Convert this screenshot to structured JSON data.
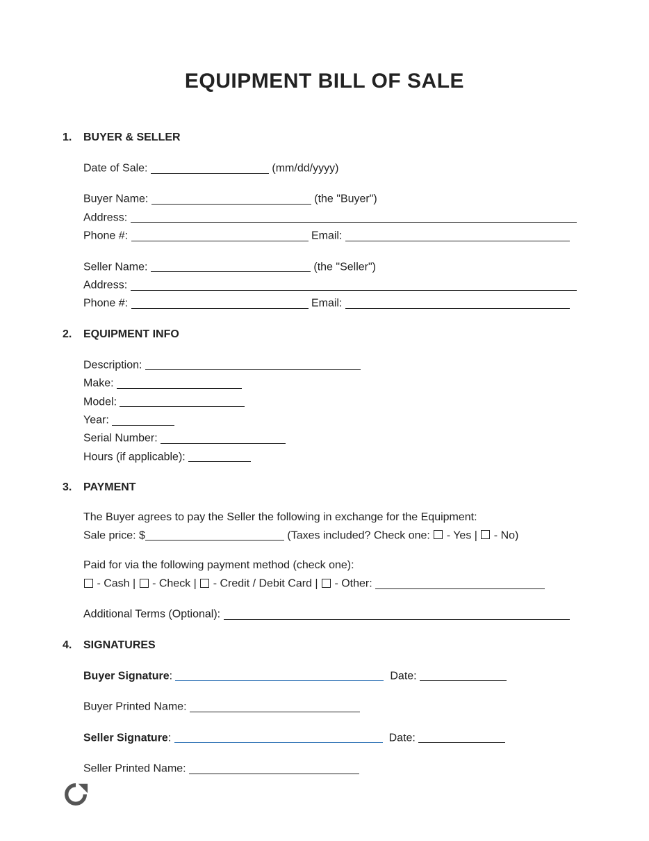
{
  "title": "EQUIPMENT BILL OF SALE",
  "s1": {
    "num": "1.",
    "heading": "BUYER & SELLER",
    "dateOfSale": "Date of Sale: ",
    "dateHint": " (mm/dd/yyyy)",
    "buyerName": "Buyer Name: ",
    "buyerTag": " (the \"Buyer\")",
    "address": "Address: ",
    "phone": "Phone #: ",
    "email": " Email: ",
    "sellerName": "Seller Name: ",
    "sellerTag": " (the \"Seller\")"
  },
  "s2": {
    "num": "2.",
    "heading": "EQUIPMENT INFO",
    "description": "Description: ",
    "make": "Make: ",
    "model": "Model: ",
    "year": "Year: ",
    "serial": "Serial Number: ",
    "hours": "Hours (if applicable): "
  },
  "s3": {
    "num": "3.",
    "heading": "PAYMENT",
    "intro": "The Buyer agrees to pay the Seller the following in exchange for the Equipment:",
    "salePrice": "Sale price: $",
    "taxesQ": " (Taxes included? Check one: ",
    "yes": " - Yes | ",
    "no": " - No)",
    "paidVia": "Paid for via the following payment method (check one):",
    "cash": " - Cash | ",
    "check": " - Check | ",
    "card": " - Credit / Debit Card | ",
    "other": " - Other: ",
    "addl": "Additional Terms (Optional): "
  },
  "s4": {
    "num": "4.",
    "heading": "SIGNATURES",
    "buyerSig": "Buyer Signature",
    "date": "Date: ",
    "buyerPrint": "Buyer Printed Name: ",
    "sellerSig": "Seller Signature",
    "sellerPrint": "Seller Printed Name: ",
    "colon": ": "
  }
}
